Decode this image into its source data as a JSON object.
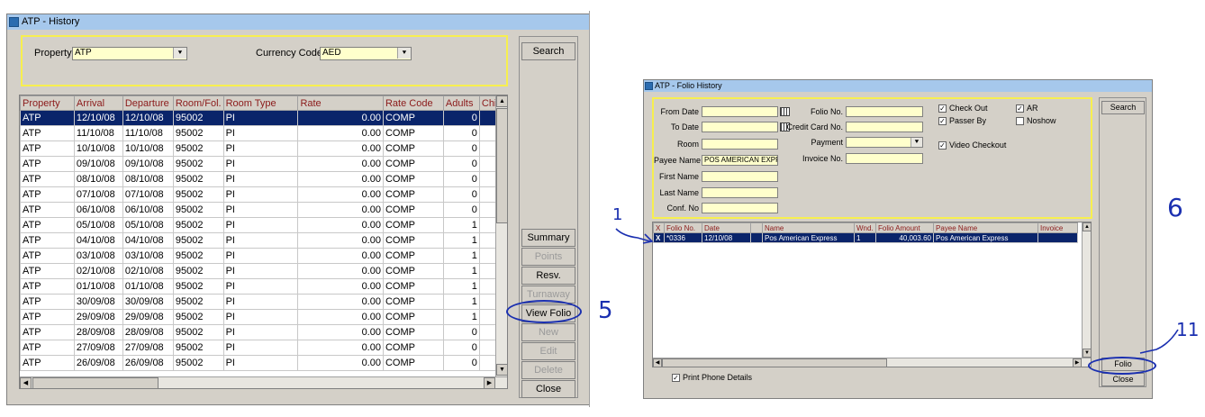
{
  "history": {
    "title": "ATP - History",
    "property_label": "Property",
    "property_value": "ATP",
    "currency_label": "Currency Code",
    "currency_value": "AED",
    "columns": [
      "Property",
      "Arrival",
      "Departure",
      "Room/Fol.",
      "Room Type",
      "Rate",
      "Rate Code",
      "Adults",
      "Child"
    ],
    "rows": [
      [
        "ATP",
        "12/10/08",
        "12/10/08",
        "95002",
        "PI",
        "0.00",
        "COMP",
        "0"
      ],
      [
        "ATP",
        "11/10/08",
        "11/10/08",
        "95002",
        "PI",
        "0.00",
        "COMP",
        "0"
      ],
      [
        "ATP",
        "10/10/08",
        "10/10/08",
        "95002",
        "PI",
        "0.00",
        "COMP",
        "0"
      ],
      [
        "ATP",
        "09/10/08",
        "09/10/08",
        "95002",
        "PI",
        "0.00",
        "COMP",
        "0"
      ],
      [
        "ATP",
        "08/10/08",
        "08/10/08",
        "95002",
        "PI",
        "0.00",
        "COMP",
        "0"
      ],
      [
        "ATP",
        "07/10/08",
        "07/10/08",
        "95002",
        "PI",
        "0.00",
        "COMP",
        "0"
      ],
      [
        "ATP",
        "06/10/08",
        "06/10/08",
        "95002",
        "PI",
        "0.00",
        "COMP",
        "0"
      ],
      [
        "ATP",
        "05/10/08",
        "05/10/08",
        "95002",
        "PI",
        "0.00",
        "COMP",
        "1"
      ],
      [
        "ATP",
        "04/10/08",
        "04/10/08",
        "95002",
        "PI",
        "0.00",
        "COMP",
        "1"
      ],
      [
        "ATP",
        "03/10/08",
        "03/10/08",
        "95002",
        "PI",
        "0.00",
        "COMP",
        "1"
      ],
      [
        "ATP",
        "02/10/08",
        "02/10/08",
        "95002",
        "PI",
        "0.00",
        "COMP",
        "1"
      ],
      [
        "ATP",
        "01/10/08",
        "01/10/08",
        "95002",
        "PI",
        "0.00",
        "COMP",
        "1"
      ],
      [
        "ATP",
        "30/09/08",
        "30/09/08",
        "95002",
        "PI",
        "0.00",
        "COMP",
        "1"
      ],
      [
        "ATP",
        "29/09/08",
        "29/09/08",
        "95002",
        "PI",
        "0.00",
        "COMP",
        "1"
      ],
      [
        "ATP",
        "28/09/08",
        "28/09/08",
        "95002",
        "PI",
        "0.00",
        "COMP",
        "0"
      ],
      [
        "ATP",
        "27/09/08",
        "27/09/08",
        "95002",
        "PI",
        "0.00",
        "COMP",
        "0"
      ],
      [
        "ATP",
        "26/09/08",
        "26/09/08",
        "95002",
        "PI",
        "0.00",
        "COMP",
        "0"
      ]
    ],
    "buttons": {
      "search": "Search",
      "summary": "Summary",
      "points": "Points",
      "resv": "Resv.",
      "turnaway": "Turnaway",
      "view_folio": "View Folio",
      "new": "New",
      "edit": "Edit",
      "delete": "Delete",
      "close": "Close"
    }
  },
  "folio": {
    "title": "ATP - Folio History",
    "labels": {
      "from_date": "From Date",
      "to_date": "To Date",
      "room": "Room",
      "payee_name": "Payee Name",
      "first_name": "First Name",
      "last_name": "Last Name",
      "conf_no": "Conf. No",
      "folio_no": "Folio No.",
      "credit_card_no": "Credit Card No.",
      "payment": "Payment",
      "invoice_no": "Invoice No."
    },
    "payee_name_value": "POS AMERICAN EXPRE",
    "checkboxes": {
      "check_out": "Check Out",
      "passer_by": "Passer By",
      "video_checkout": "Video Checkout",
      "ar": "AR",
      "noshow": "Noshow",
      "print_phone_details": "Print Phone Details"
    },
    "checked_mark": "✓",
    "columns": [
      "X",
      "Folio No.",
      "Date",
      "",
      "Name",
      "Wnd.",
      "Folio Amount",
      "Payee Name",
      "Invoice"
    ],
    "row": {
      "x": "X",
      "folio_no": "*0336",
      "date": "12/10/08",
      "name": "Pos American Express",
      "wnd": "1",
      "amount": "40,003.60",
      "payee": "Pos American Express"
    },
    "buttons": {
      "search": "Search",
      "folio": "Folio",
      "close": "Close"
    }
  },
  "annotations": {
    "step1": "1",
    "step5": "5",
    "step6": "6",
    "step11": "11"
  }
}
